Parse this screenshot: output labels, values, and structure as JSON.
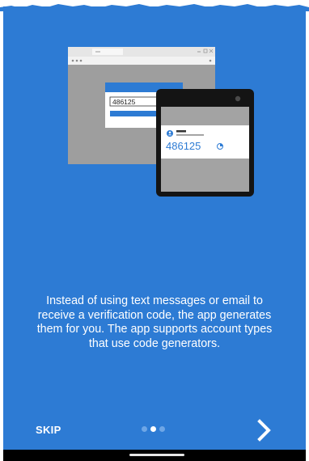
{
  "illustration": {
    "desktop_code": "486125",
    "phone_code": "486125"
  },
  "description": "Instead of using text messages or email to receive a verification code, the app generates them for you. The app supports account types that use code generators.",
  "navigation": {
    "skip_label": "SKIP",
    "page_count": 3,
    "current_page": 2
  },
  "colors": {
    "background": "#2d7bd4",
    "accent_text": "#2d7bd4"
  },
  "icons": {
    "next": "chevron-right-icon",
    "account": "person-icon",
    "timer": "timer-icon"
  }
}
